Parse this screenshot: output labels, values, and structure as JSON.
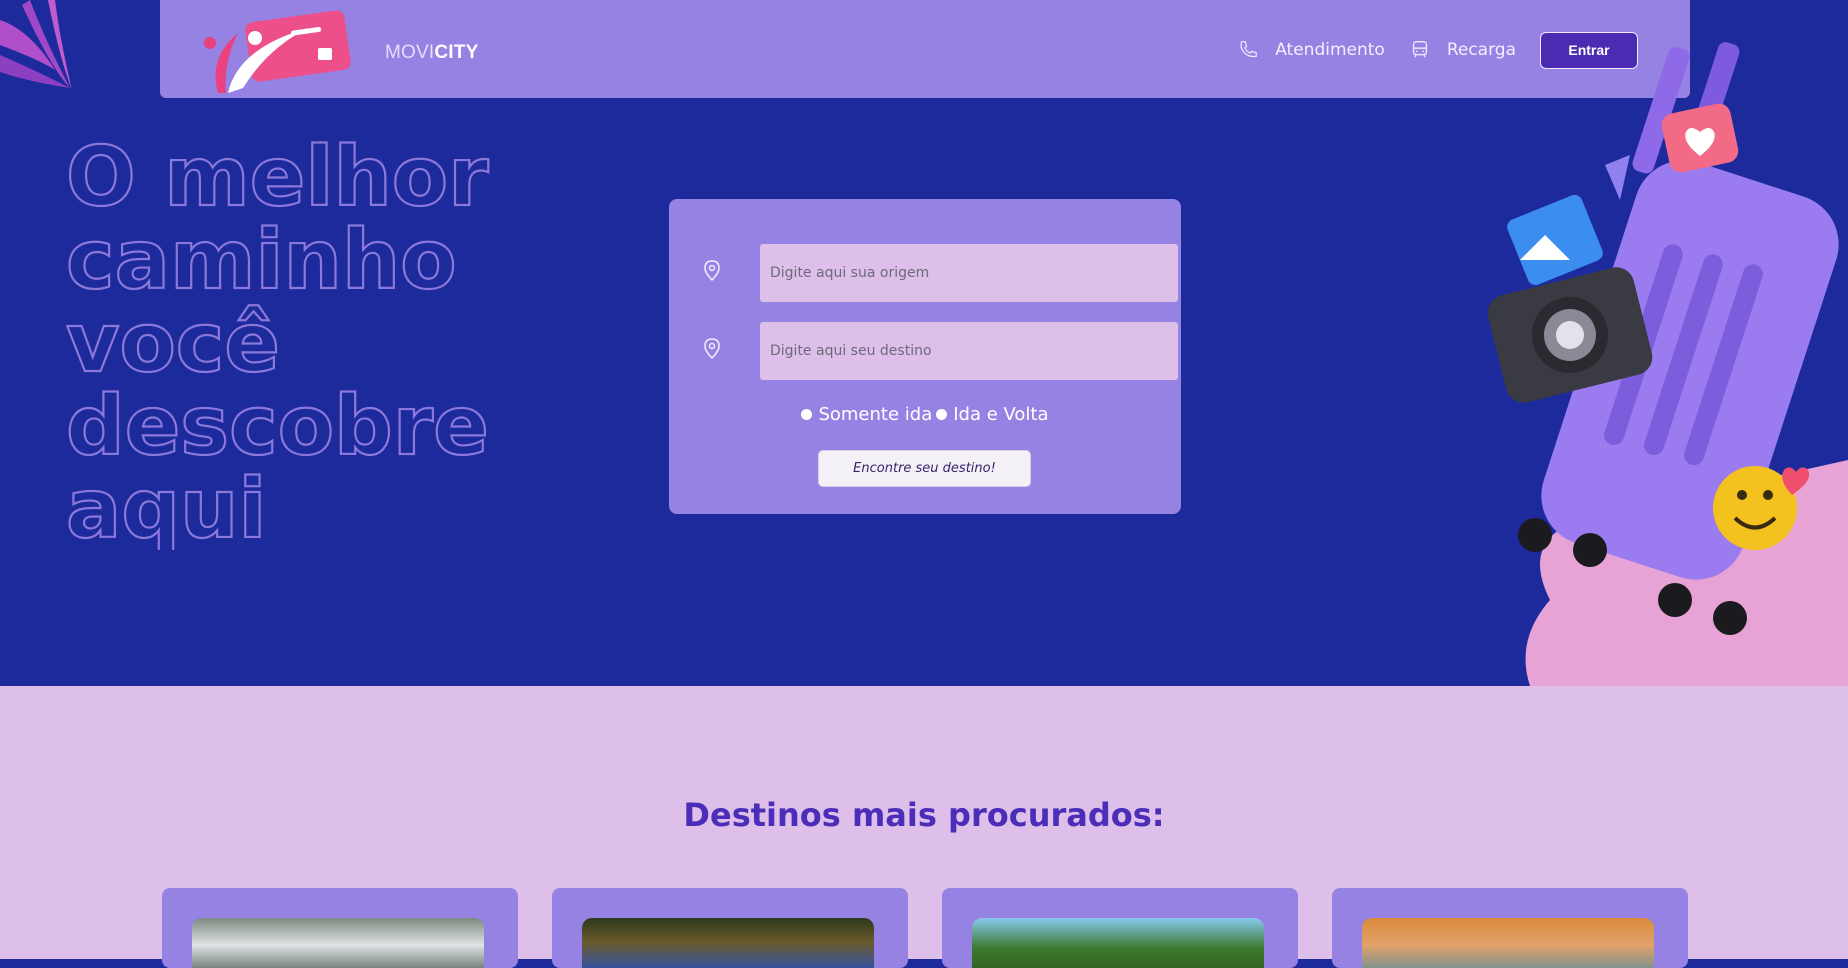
{
  "brand": {
    "name_light": "MOVI",
    "name_bold": "CITY"
  },
  "nav": {
    "support_label": "Atendimento",
    "recharge_label": "Recarga",
    "login_label": "Entrar"
  },
  "hero": {
    "headline_lines": [
      "O melhor",
      "caminho",
      "você",
      "descobre",
      "aqui"
    ]
  },
  "search": {
    "origin_placeholder": "Digite aqui sua origem",
    "destination_placeholder": "Digite aqui seu destino",
    "trip_options": [
      "Somente ida",
      "Ida e Volta"
    ],
    "submit_label": "Encontre seu destino!"
  },
  "destinations": {
    "title": "Destinos mais procurados:",
    "cards": [
      {
        "image": "city-palms-photo"
      },
      {
        "image": "resort-pool-photo"
      },
      {
        "image": "beach-palms-photo"
      },
      {
        "image": "sunset-sea-photo"
      }
    ]
  },
  "colors": {
    "hero_bg": "#1c2a9c",
    "panel": "#9582e3",
    "field_bg": "#ddbfea",
    "accent": "#4a2db8",
    "section_bg": "#ddbfea"
  }
}
